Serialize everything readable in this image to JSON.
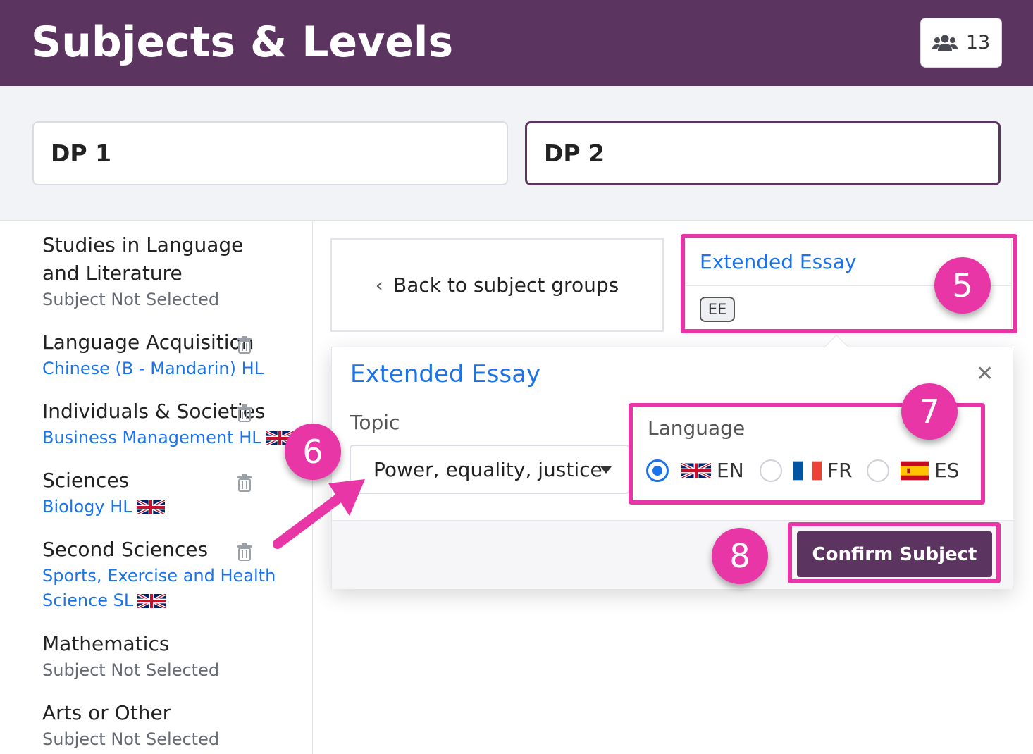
{
  "header": {
    "title": "Subjects & Levels",
    "user_count": "13",
    "user_icon": "users-icon"
  },
  "tabs": [
    {
      "label": "DP 1",
      "active": false
    },
    {
      "label": "DP 2",
      "active": true
    }
  ],
  "sidebar": {
    "groups": [
      {
        "title": "Studies in Language and Literature",
        "subtitle": "Subject Not Selected",
        "status": "muted",
        "flag": null,
        "deletable": false
      },
      {
        "title": "Language Acquisition",
        "subtitle": "Chinese (B - Mandarin) HL",
        "status": "link",
        "flag": null,
        "deletable": true
      },
      {
        "title": "Individuals & Societies",
        "subtitle": "Business Management HL",
        "status": "link",
        "flag": "uk-flag",
        "deletable": true
      },
      {
        "title": "Sciences",
        "subtitle": "Biology HL",
        "status": "link",
        "flag": "uk-flag",
        "deletable": true
      },
      {
        "title": "Second Sciences",
        "subtitle_line1": "Sports, Exercise and Health",
        "subtitle_line2": "Science SL",
        "status": "link",
        "flag": "uk-flag",
        "deletable": true
      },
      {
        "title": "Mathematics",
        "subtitle": "Subject Not Selected",
        "status": "muted",
        "flag": null,
        "deletable": false
      },
      {
        "title": "Arts or Other",
        "subtitle": "Subject Not Selected",
        "status": "muted",
        "flag": null,
        "deletable": false
      }
    ]
  },
  "main": {
    "back_label": "Back to subject groups",
    "ee_card": {
      "title": "Extended Essay",
      "badge": "EE"
    },
    "popup": {
      "title": "Extended Essay",
      "close_icon": "close-icon",
      "topic_label": "Topic",
      "topic_value": "Power, equality, justice",
      "language_label": "Language",
      "languages": [
        {
          "code": "EN",
          "flag": "uk-flag",
          "selected": true
        },
        {
          "code": "FR",
          "flag": "fr-flag",
          "selected": false
        },
        {
          "code": "ES",
          "flag": "es-flag",
          "selected": false
        }
      ],
      "confirm_label": "Confirm Subject"
    }
  },
  "callouts": {
    "step5": "5",
    "step6": "6",
    "step7": "7",
    "step8": "8"
  },
  "colors": {
    "brand": "#5b3460",
    "link": "#1a73e8",
    "highlight": "#e936a7"
  }
}
